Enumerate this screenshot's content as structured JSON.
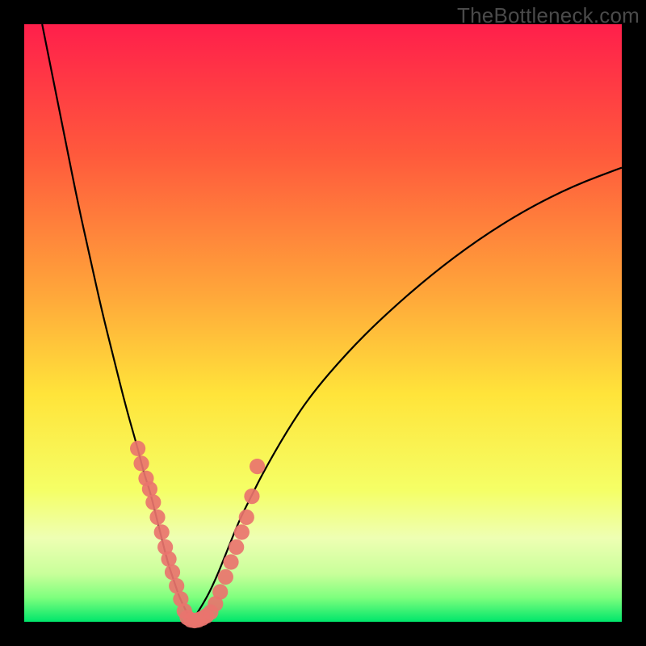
{
  "watermark": "TheBottleneck.com",
  "chart_data": {
    "type": "line",
    "title": "",
    "xlabel": "",
    "ylabel": "",
    "xlim": [
      0,
      100
    ],
    "ylim": [
      0,
      100
    ],
    "gradient_stops": [
      {
        "pct": 0,
        "color": "#ff1f4b"
      },
      {
        "pct": 22,
        "color": "#ff5a3c"
      },
      {
        "pct": 45,
        "color": "#ffa63a"
      },
      {
        "pct": 62,
        "color": "#ffe43a"
      },
      {
        "pct": 78,
        "color": "#f5ff66"
      },
      {
        "pct": 86,
        "color": "#eeffb3"
      },
      {
        "pct": 92,
        "color": "#c8ff9a"
      },
      {
        "pct": 96,
        "color": "#7dff7d"
      },
      {
        "pct": 100,
        "color": "#00e66b"
      }
    ],
    "series": [
      {
        "name": "bottleneck-curve-left",
        "type": "line",
        "x": [
          3,
          5,
          7,
          9,
          11,
          13,
          15,
          17,
          19,
          20,
          21,
          22,
          23,
          24,
          25,
          26,
          27,
          28
        ],
        "y": [
          100,
          90,
          80,
          70,
          61,
          52,
          44,
          36,
          29,
          25,
          22,
          18,
          14,
          10,
          7,
          4,
          2,
          0
        ]
      },
      {
        "name": "bottleneck-curve-right",
        "type": "line",
        "x": [
          28,
          30,
          32,
          34,
          36,
          38,
          40,
          44,
          48,
          54,
          60,
          68,
          76,
          84,
          92,
          100
        ],
        "y": [
          0,
          3,
          7,
          12,
          17,
          21,
          25,
          32,
          38,
          45,
          51,
          58,
          64,
          69,
          73,
          76
        ]
      },
      {
        "name": "scatter-left-branch",
        "type": "scatter",
        "x": [
          19,
          19.6,
          20.4,
          21,
          21.6,
          22.3,
          23,
          23.6,
          24.2,
          24.8,
          25.5,
          26.2,
          26.8
        ],
        "y": [
          29,
          26.5,
          24,
          22.2,
          20,
          17.5,
          15,
          12.5,
          10.5,
          8.3,
          6,
          3.8,
          1.8
        ]
      },
      {
        "name": "scatter-bottom",
        "type": "scatter",
        "x": [
          27.3,
          27.9,
          28.5,
          29.1,
          29.8,
          30.5,
          31.2
        ],
        "y": [
          0.7,
          0.3,
          0.2,
          0.3,
          0.6,
          1.0,
          1.6
        ]
      },
      {
        "name": "scatter-right-branch",
        "type": "scatter",
        "x": [
          32,
          32.8,
          33.7,
          34.6,
          35.5,
          36.4,
          37.2,
          38.1,
          39
        ],
        "y": [
          3,
          5,
          7.5,
          10,
          12.5,
          15,
          17.5,
          21,
          26
        ]
      }
    ]
  }
}
